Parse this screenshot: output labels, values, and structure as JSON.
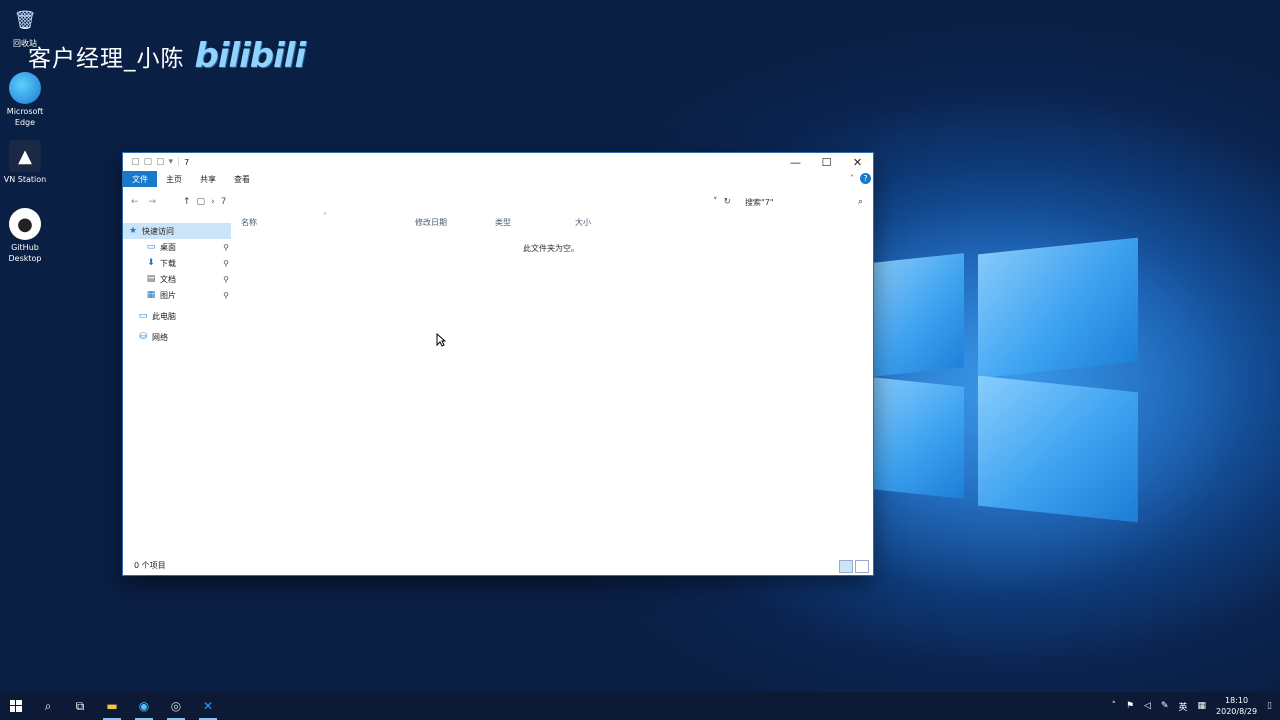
{
  "watermark": {
    "text": "客户经理_小陈",
    "logo": "bilibili"
  },
  "desktop": {
    "icons": [
      {
        "label": "回收站",
        "icon": "recycle-bin-icon"
      },
      {
        "label": "Microsoft Edge",
        "icon": "edge-icon"
      },
      {
        "label": "VN Station",
        "icon": "vn-station-icon"
      },
      {
        "label": "GitHub Desktop",
        "icon": "github-icon"
      }
    ]
  },
  "window": {
    "title": "7",
    "ribbon_tabs": [
      "文件",
      "主页",
      "共享",
      "查看"
    ],
    "address": {
      "back": "←",
      "forward": "→",
      "up": "↑",
      "crumb": "7"
    },
    "search_placeholder": "搜索\"7\"",
    "nav": {
      "quick_access": "快速访问",
      "desktop": "桌面",
      "downloads": "下载",
      "documents": "文档",
      "pictures": "图片",
      "this_pc": "此电脑",
      "network": "网络"
    },
    "columns": {
      "name": "名称",
      "modified": "修改日期",
      "type": "类型",
      "size": "大小"
    },
    "empty_message": "此文件夹为空。",
    "status": "0 个项目"
  },
  "taskbar": {
    "time": "18:10",
    "date": "2020/8/29",
    "ime": "英"
  },
  "colors": {
    "accent": "#1979ca",
    "taskbar": "#0c1a36",
    "selection": "#cce4f7"
  }
}
